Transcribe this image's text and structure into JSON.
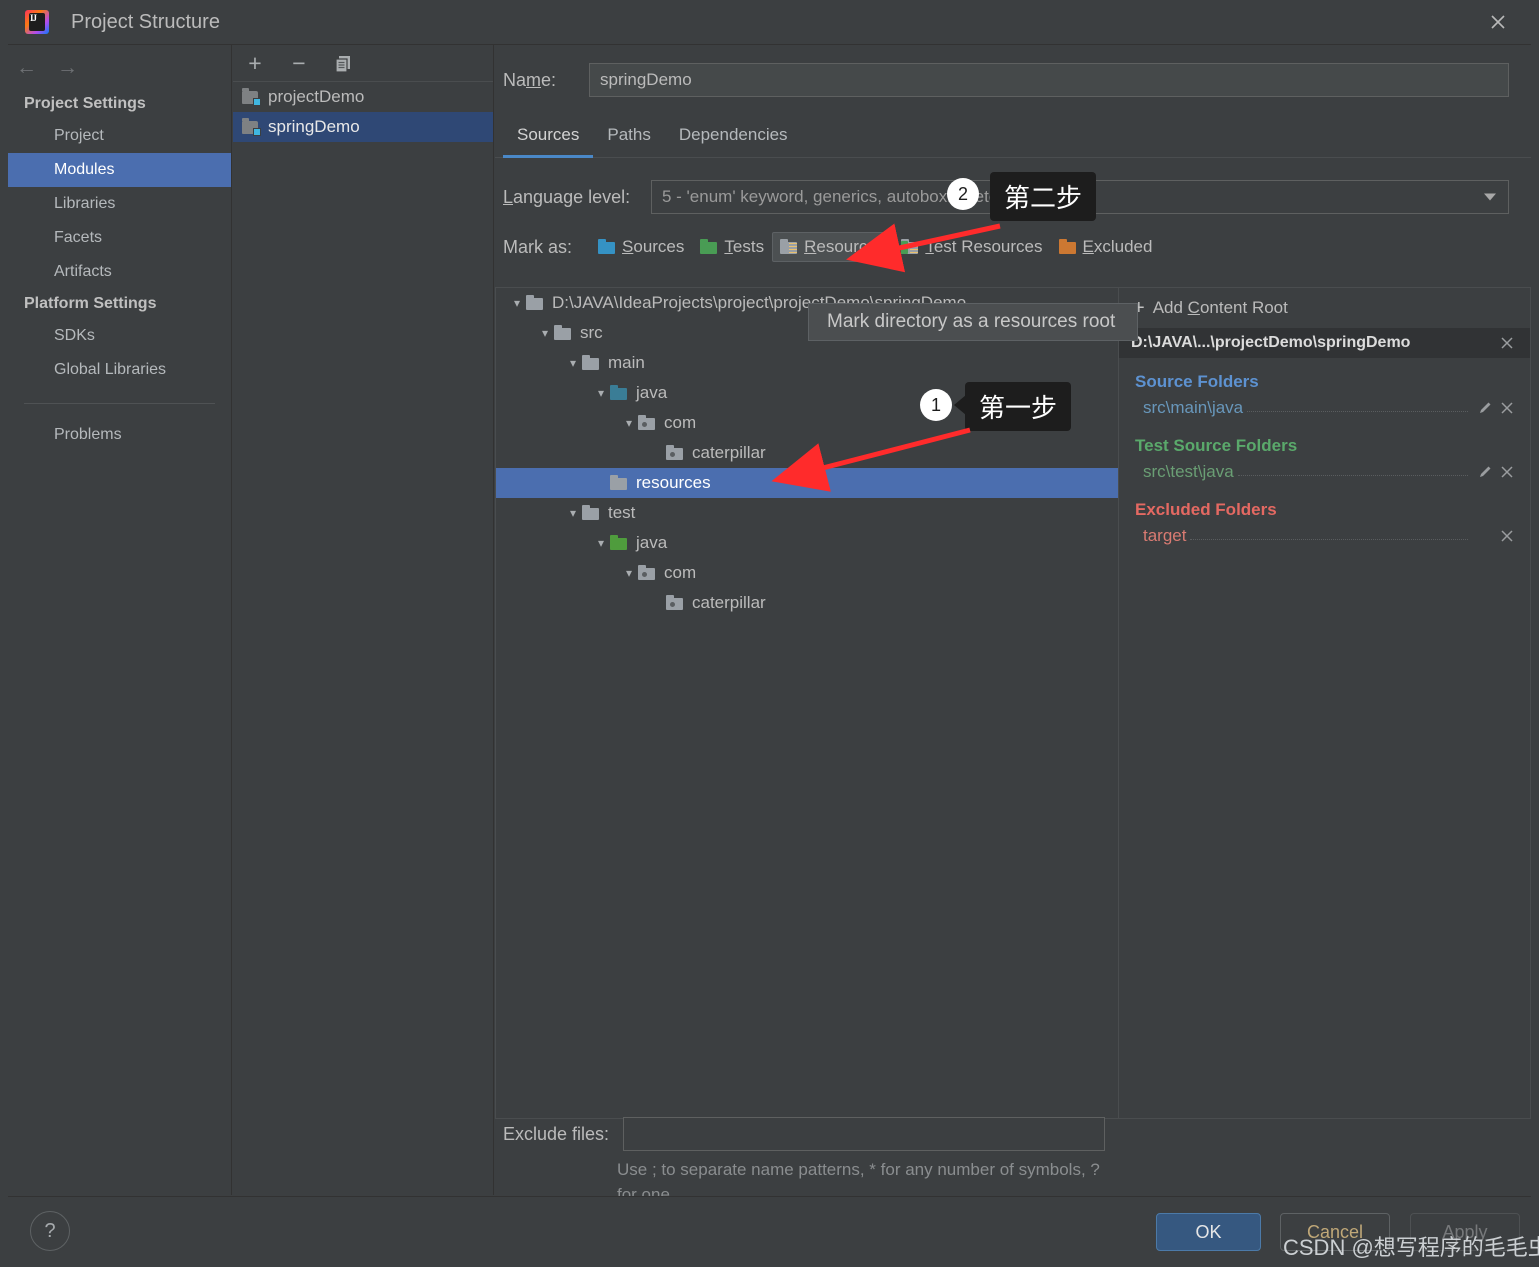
{
  "window": {
    "title": "Project Structure",
    "close_icon": "close-icon",
    "logo_text": "IJ"
  },
  "sidebar": {
    "back_icon": "←",
    "forward_icon": "→",
    "groups": [
      {
        "heading": "Project Settings",
        "items": [
          {
            "label": "Project",
            "selected": false
          },
          {
            "label": "Modules",
            "selected": true
          },
          {
            "label": "Libraries",
            "selected": false
          },
          {
            "label": "Facets",
            "selected": false
          },
          {
            "label": "Artifacts",
            "selected": false
          }
        ]
      },
      {
        "heading": "Platform Settings",
        "items": [
          {
            "label": "SDKs",
            "selected": false
          },
          {
            "label": "Global Libraries",
            "selected": false
          }
        ]
      }
    ],
    "problems_label": "Problems"
  },
  "modules_panel": {
    "toolbar": {
      "add_icon": "+",
      "remove_icon": "−",
      "copy_icon": "copy-icon"
    },
    "modules": [
      {
        "name": "projectDemo",
        "selected": false
      },
      {
        "name": "springDemo",
        "selected": true
      }
    ]
  },
  "main": {
    "name_label_pre": "Na",
    "name_label_mnemonic": "m",
    "name_label_post": "e:",
    "name_value": "springDemo",
    "tabs": [
      {
        "label": "Sources",
        "active": true
      },
      {
        "label": "Paths",
        "active": false
      },
      {
        "label": "Dependencies",
        "active": false
      }
    ],
    "language_level": {
      "label_mnemonic": "L",
      "label_rest": "anguage level:",
      "value": "5 - 'enum' keyword, generics, autoboxing etc.",
      "caret_icon": "chevron-down-icon"
    },
    "mark_as": {
      "label": "Mark as:",
      "buttons": [
        {
          "label_pre": "",
          "mnemonic": "S",
          "label_post": "ources",
          "icon": "folder-sources-icon",
          "color": "#3592c4",
          "hover": false
        },
        {
          "label_pre": "",
          "mnemonic": "T",
          "label_post": "ests",
          "icon": "folder-tests-icon",
          "color": "#499c54",
          "hover": false
        },
        {
          "label_pre": "",
          "mnemonic": "R",
          "label_post": "esources",
          "icon": "folder-resources-icon",
          "color": "#9aa0a6",
          "hover": true
        },
        {
          "label_pre": "",
          "mnemonic": "T",
          "label_post": "est Resources",
          "icon": "folder-test-resources-icon",
          "color": "#9aa0a6",
          "hover": false
        },
        {
          "label_pre": "",
          "mnemonic": "E",
          "label_post": "xcluded",
          "icon": "folder-excluded-icon",
          "color": "#cc7832",
          "hover": false
        }
      ]
    },
    "tree": [
      {
        "label": "D:\\JAVA\\IdeaProjects\\project\\projectDemo\\springDemo",
        "depth": 0,
        "kind": "content-root",
        "expanded": true,
        "selected": false
      },
      {
        "label": "src",
        "depth": 1,
        "kind": "plain",
        "expanded": true,
        "selected": false
      },
      {
        "label": "main",
        "depth": 2,
        "kind": "plain",
        "expanded": true,
        "selected": false
      },
      {
        "label": "java",
        "depth": 3,
        "kind": "source",
        "expanded": true,
        "selected": false
      },
      {
        "label": "com",
        "depth": 4,
        "kind": "package",
        "expanded": true,
        "selected": false
      },
      {
        "label": "caterpillar",
        "depth": 5,
        "kind": "package",
        "expanded": false,
        "selected": false
      },
      {
        "label": "resources",
        "depth": 3,
        "kind": "plain",
        "expanded": false,
        "selected": true
      },
      {
        "label": "test",
        "depth": 2,
        "kind": "plain",
        "expanded": true,
        "selected": false
      },
      {
        "label": "java",
        "depth": 3,
        "kind": "test-source",
        "expanded": true,
        "selected": false
      },
      {
        "label": "com",
        "depth": 4,
        "kind": "package",
        "expanded": true,
        "selected": false
      },
      {
        "label": "caterpillar",
        "depth": 5,
        "kind": "package",
        "expanded": false,
        "selected": false
      }
    ],
    "right_panel": {
      "add_content_root_pre": "Add ",
      "add_content_root_mnemonic": "C",
      "add_content_root_post": "ontent Root",
      "add_icon": "+",
      "content_root": "D:\\JAVA\\...\\projectDemo\\springDemo",
      "content_root_remove_icon": "close-icon",
      "sections": [
        {
          "title": "Source Folders",
          "color": "#5d92d1",
          "entries": [
            {
              "path": "src\\main\\java",
              "edit_icon": "pencil-icon",
              "remove_icon": "close-icon"
            }
          ]
        },
        {
          "title": "Test Source Folders",
          "color": "#5aa96b",
          "entries": [
            {
              "path": "src\\test\\java",
              "edit_icon": "pencil-icon",
              "remove_icon": "close-icon"
            }
          ]
        },
        {
          "title": "Excluded Folders",
          "color": "#e46962",
          "entries": [
            {
              "path": "target",
              "edit_icon": "",
              "remove_icon": "close-icon"
            }
          ]
        }
      ]
    },
    "exclude_files": {
      "label": "Exclude files:",
      "value": "",
      "hint": "Use ; to separate name patterns, * for any number of symbols, ? for one."
    }
  },
  "tooltip": {
    "text": "Mark directory as a resources root"
  },
  "annotations": [
    {
      "number": "1",
      "text": "第一步"
    },
    {
      "number": "2",
      "text": "第二步"
    }
  ],
  "bottom_bar": {
    "help_icon": "?",
    "ok_label": "OK",
    "cancel_label": "Cancel",
    "apply_label": "Apply"
  },
  "watermark": "CSDN @想写程序的毛毛虫"
}
